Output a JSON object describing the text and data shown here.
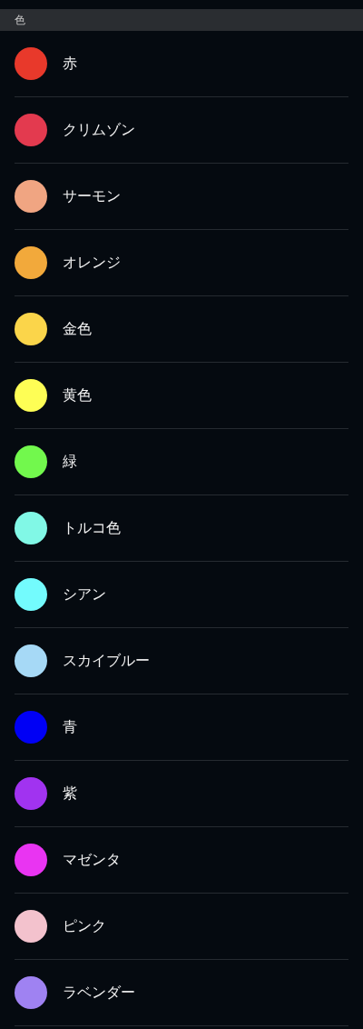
{
  "section_header": "色",
  "colors": [
    {
      "name": "赤",
      "color": "#e8392b"
    },
    {
      "name": "クリムゾン",
      "color": "#e33a4f"
    },
    {
      "name": "サーモン",
      "color": "#f0a582"
    },
    {
      "name": "オレンジ",
      "color": "#f2a93b"
    },
    {
      "name": "金色",
      "color": "#fbd54a"
    },
    {
      "name": "黄色",
      "color": "#fefe55"
    },
    {
      "name": "緑",
      "color": "#72f84d"
    },
    {
      "name": "トルコ色",
      "color": "#81f8e6"
    },
    {
      "name": "シアン",
      "color": "#73fbfd"
    },
    {
      "name": "スカイブルー",
      "color": "#a6d9f6"
    },
    {
      "name": "青",
      "color": "#0000f5"
    },
    {
      "name": "紫",
      "color": "#a133f0"
    },
    {
      "name": "マゼンタ",
      "color": "#e934f2"
    },
    {
      "name": "ピンク",
      "color": "#f3c2cd"
    },
    {
      "name": "ラベンダー",
      "color": "#9f82f2"
    }
  ]
}
